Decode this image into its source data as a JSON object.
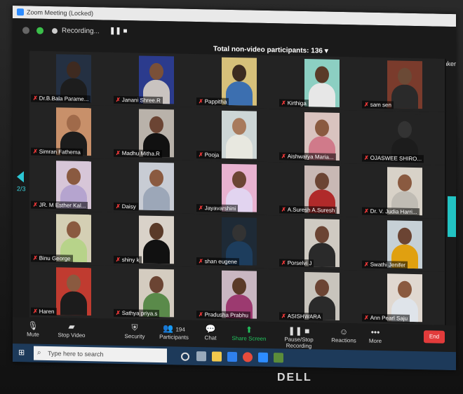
{
  "window": {
    "title": "Zoom Meeting (Locked)"
  },
  "topbar": {
    "recording": "Recording...",
    "nonvideo": "Total non-video participants: 136",
    "speaker": "Speaker"
  },
  "page_indicator": "2/3",
  "participants": [
    {
      "name": "Dr.B.Bala Parame...",
      "skin": "#3e2a20",
      "shirt": "#1d1d1d",
      "bg": "#243042"
    },
    {
      "name": "Janani Shree.R",
      "skin": "#7a5038",
      "shirt": "#c9c3c0",
      "bg": "#2b3b8d"
    },
    {
      "name": "Pappitha",
      "skin": "#3b2a20",
      "shirt": "#3c6fb0",
      "bg": "#d6c07a"
    },
    {
      "name": "Kirthiga",
      "skin": "#5a3a28",
      "shirt": "#e7e7e7",
      "bg": "#8ccfc2"
    },
    {
      "name": "sam sen",
      "skin": "#6b4a36",
      "shirt": "#2a2a2a",
      "bg": "#7a3b2c"
    },
    {
      "name": "Simran Fathema",
      "skin": "#a06a4a",
      "shirt": "#1c1c1c",
      "bg": "#c8906a"
    },
    {
      "name": "Madhu Mitha.R",
      "skin": "#6b4433",
      "shirt": "#111111",
      "bg": "#b9b2aa"
    },
    {
      "name": "Pooja",
      "skin": "#a87a5c",
      "shirt": "#e8e8e0",
      "bg": "#cdd6d6"
    },
    {
      "name": "Aishwarya Maria...",
      "skin": "#8a5a40",
      "shirt": "#d07a8a",
      "bg": "#d9c3bf"
    },
    {
      "name": "OJASWEE SHIRO...",
      "skin": "#333333",
      "shirt": "#1c1c1c",
      "bg": "#232323"
    },
    {
      "name": "JR. M Esther Kal...",
      "skin": "#8a5a40",
      "shirt": "#b5a4cf",
      "bg": "#d7c6d8"
    },
    {
      "name": "Daisy",
      "skin": "#8a5a40",
      "shirt": "#9ca7b8",
      "bg": "#c8ccd4"
    },
    {
      "name": "Jayavarshini",
      "skin": "#6b4433",
      "shirt": "#e2d4f0",
      "bg": "#e8b2d0"
    },
    {
      "name": "A.Suresh A.Suresh",
      "skin": "#6b4433",
      "shirt": "#b02a2a",
      "bg": "#c8b8b4"
    },
    {
      "name": "Dr. V. Judia Harri...",
      "skin": "#8a5a40",
      "shirt": "#c0bcb4",
      "bg": "#d8d2c8"
    },
    {
      "name": "Binu George",
      "skin": "#8a5a40",
      "shirt": "#b7d38a",
      "bg": "#d4cfb4"
    },
    {
      "name": "shiny k",
      "skin": "#5a3a28",
      "shirt": "#111111",
      "bg": "#d9d2c9"
    },
    {
      "name": "shan eugene",
      "skin": "#333333",
      "shirt": "#1d3d5d",
      "bg": "#1e2a36"
    },
    {
      "name": "Porselvi J",
      "skin": "#6b4433",
      "shirt": "#2a2a2a",
      "bg": "#cfcac2"
    },
    {
      "name": "Swathi Jenifer",
      "skin": "#6b4433",
      "shirt": "#e0a010",
      "bg": "#c6d0d6"
    },
    {
      "name": "Haren",
      "skin": "#8a5a40",
      "shirt": "#1c1c1c",
      "bg": "#c03b30"
    },
    {
      "name": "Sathya priya.s",
      "skin": "#6b4433",
      "shirt": "#5a8a4a",
      "bg": "#d4ccc0"
    },
    {
      "name": "Pradusha Prabhu",
      "skin": "#5a3a28",
      "shirt": "#9c3a70",
      "bg": "#c9b7c2"
    },
    {
      "name": "ASISHWARA",
      "skin": "#6b4433",
      "shirt": "#2a2a2a",
      "bg": "#c8c4bc"
    },
    {
      "name": "Ann Pearl Saju",
      "skin": "#8a5a40",
      "shirt": "#dfe4ea",
      "bg": "#e0d8d0"
    }
  ],
  "toolbar": {
    "mute": "Mute",
    "stop_video": "Stop Video",
    "security": "Security",
    "participants": "Participants",
    "participants_count": "194",
    "chat": "Chat",
    "share_screen": "Share Screen",
    "pause_recording": "Pause/Stop Recording",
    "reactions": "Reactions",
    "more": "More",
    "end": "End"
  },
  "taskbar": {
    "search_placeholder": "Type here to search"
  },
  "brand": "DELL",
  "colors": {
    "accent": "#2cc6d4",
    "end": "#e23b3b",
    "share": "#22c55e"
  }
}
